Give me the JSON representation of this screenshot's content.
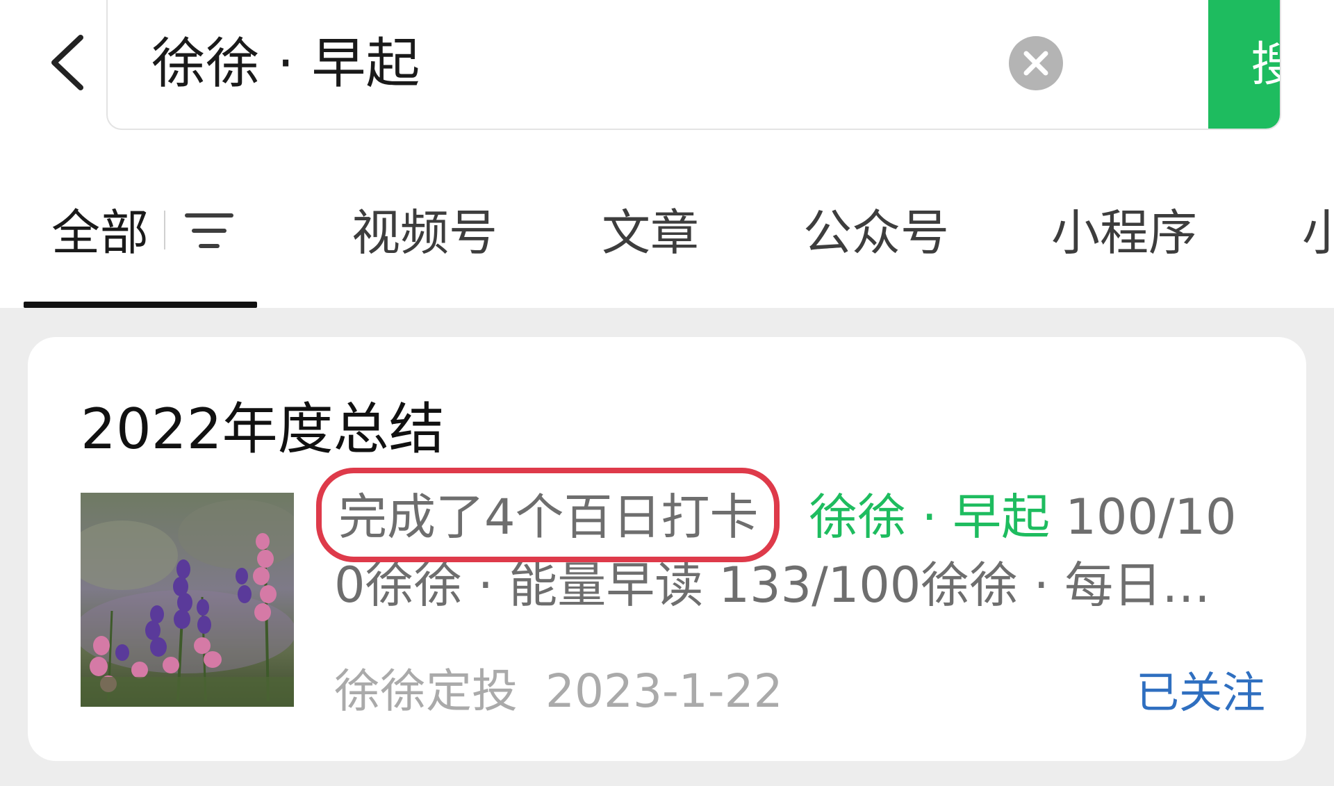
{
  "search": {
    "query": "徐徐 · 早起",
    "button_label": "搜索"
  },
  "tabs": [
    {
      "label": "全部",
      "active": true
    },
    {
      "label": "视频号"
    },
    {
      "label": "文章"
    },
    {
      "label": "公众号"
    },
    {
      "label": "小程序"
    },
    {
      "label": "小"
    }
  ],
  "result": {
    "title": "2022年度总结",
    "snippet": {
      "circled_text": "完成了4个百日打卡",
      "highlight": "徐徐 · 早起",
      "line1_tail": " 100/10",
      "line2": "0徐徐 · 能量早读 133/100徐徐 · 每日…"
    },
    "account": "徐徐定投",
    "date": "2023-1-22",
    "follow_label": "已关注"
  },
  "colors": {
    "accent": "#1ebc5f",
    "link": "#2f6fc0",
    "annotation": "#de3a4a"
  }
}
